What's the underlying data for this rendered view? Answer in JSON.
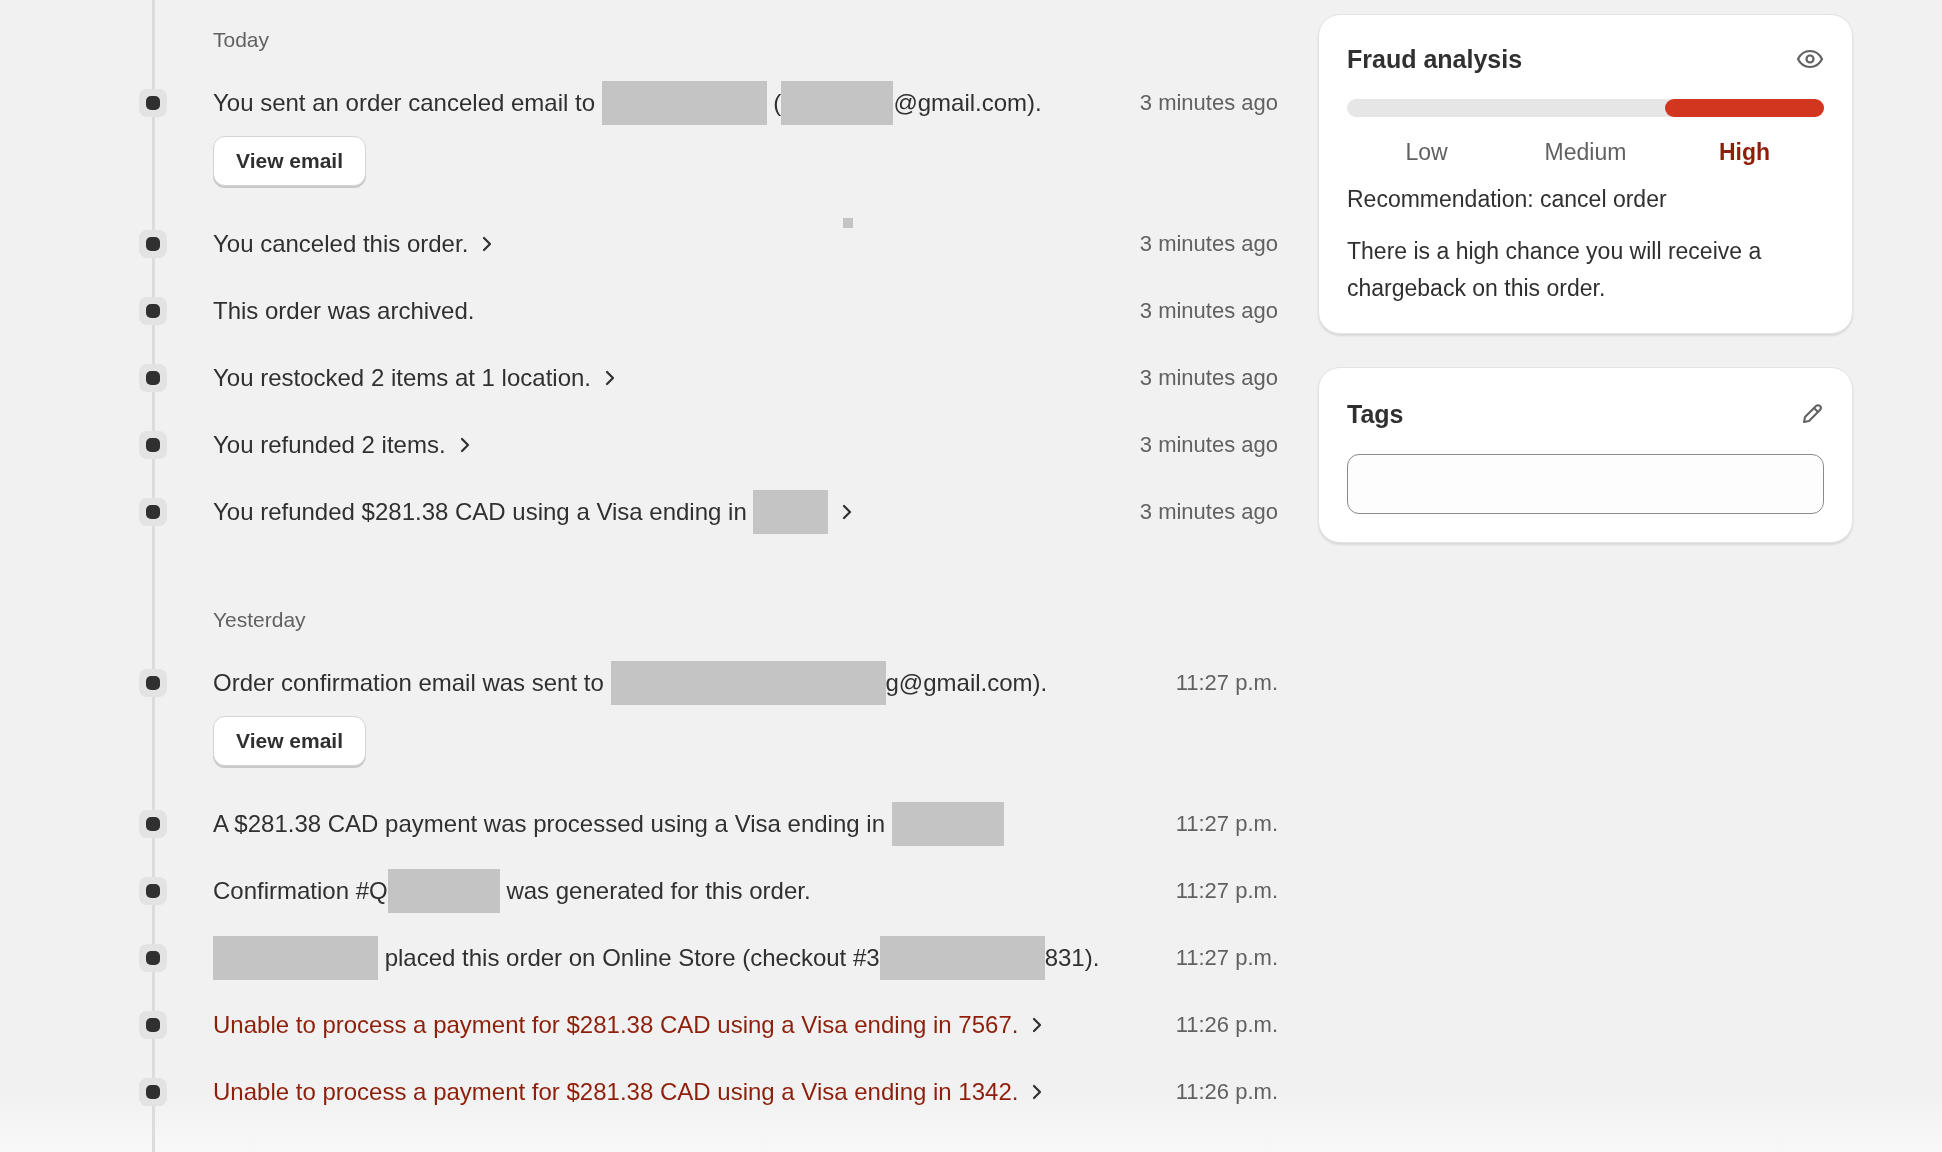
{
  "timeline": [
    {
      "heading": "Today",
      "events": [
        {
          "parts": [
            {
              "kind": "text",
              "text": "You sent an order canceled email to "
            },
            {
              "kind": "long-redaction"
            },
            {
              "kind": "text",
              "text": " ("
            },
            {
              "kind": "medium-redaction"
            },
            {
              "kind": "text",
              "text": "@gmail.com)."
            }
          ],
          "time": "3 minutes ago",
          "link": false,
          "error": false,
          "button": "View email"
        },
        {
          "parts": [
            {
              "kind": "text",
              "text": "You canceled this order."
            }
          ],
          "time": "3 minutes ago",
          "link": true,
          "error": false
        },
        {
          "parts": [
            {
              "kind": "text",
              "text": "This order was archived."
            }
          ],
          "time": "3 minutes ago",
          "link": false,
          "error": false
        },
        {
          "parts": [
            {
              "kind": "text",
              "text": "You restocked 2 items at 1 location."
            }
          ],
          "time": "3 minutes ago",
          "link": true,
          "error": false
        },
        {
          "parts": [
            {
              "kind": "text",
              "text": "You refunded 2 items."
            }
          ],
          "time": "3 minutes ago",
          "link": true,
          "error": false
        },
        {
          "parts": [
            {
              "kind": "text",
              "text": "You refunded $281.38 CAD using a Visa ending in "
            },
            {
              "kind": "short-redaction"
            }
          ],
          "time": "3 minutes ago",
          "link": true,
          "error": false
        }
      ]
    },
    {
      "heading": "Yesterday",
      "events": [
        {
          "parts": [
            {
              "kind": "text",
              "text": "Order confirmation email was sent to "
            },
            {
              "kind": "extra-long-redaction"
            },
            {
              "kind": "text",
              "text": "g@gmail.com)."
            }
          ],
          "time": "11:27 p.m.",
          "link": false,
          "error": false,
          "button": "View email"
        },
        {
          "parts": [
            {
              "kind": "text",
              "text": "A $281.38 CAD payment was processed using a Visa ending in "
            },
            {
              "kind": "medium-redaction"
            }
          ],
          "time": "11:27 p.m.",
          "link": false,
          "error": false
        },
        {
          "parts": [
            {
              "kind": "text",
              "text": "Confirmation #Q"
            },
            {
              "kind": "medium-redaction"
            },
            {
              "kind": "text",
              "text": " was generated for this order."
            }
          ],
          "time": "11:27 p.m.",
          "link": false,
          "error": false
        },
        {
          "parts": [
            {
              "kind": "long-redaction"
            },
            {
              "kind": "text",
              "text": " placed this order on Online Store (checkout #3"
            },
            {
              "kind": "long-redaction"
            },
            {
              "kind": "text",
              "text": "831)."
            }
          ],
          "time": "11:27 p.m.",
          "link": false,
          "error": false
        },
        {
          "parts": [
            {
              "kind": "text",
              "text": "Unable to process a payment for $281.38 CAD using a Visa ending in 7567."
            }
          ],
          "time": "11:26 p.m.",
          "link": true,
          "error": true
        },
        {
          "parts": [
            {
              "kind": "text",
              "text": "Unable to process a payment for $281.38 CAD using a Visa ending in 1342."
            }
          ],
          "time": "11:26 p.m.",
          "link": true,
          "error": true
        }
      ]
    }
  ],
  "fraud_analysis": {
    "title": "Fraud analysis",
    "levels": [
      {
        "label": "Low",
        "selected": false
      },
      {
        "label": "Medium",
        "selected": false
      },
      {
        "label": "High",
        "selected": true
      }
    ],
    "recommendation": "Recommendation: cancel order",
    "description": "There is a high chance you will receive a chargeback on this order."
  },
  "tags": {
    "title": "Tags"
  }
}
